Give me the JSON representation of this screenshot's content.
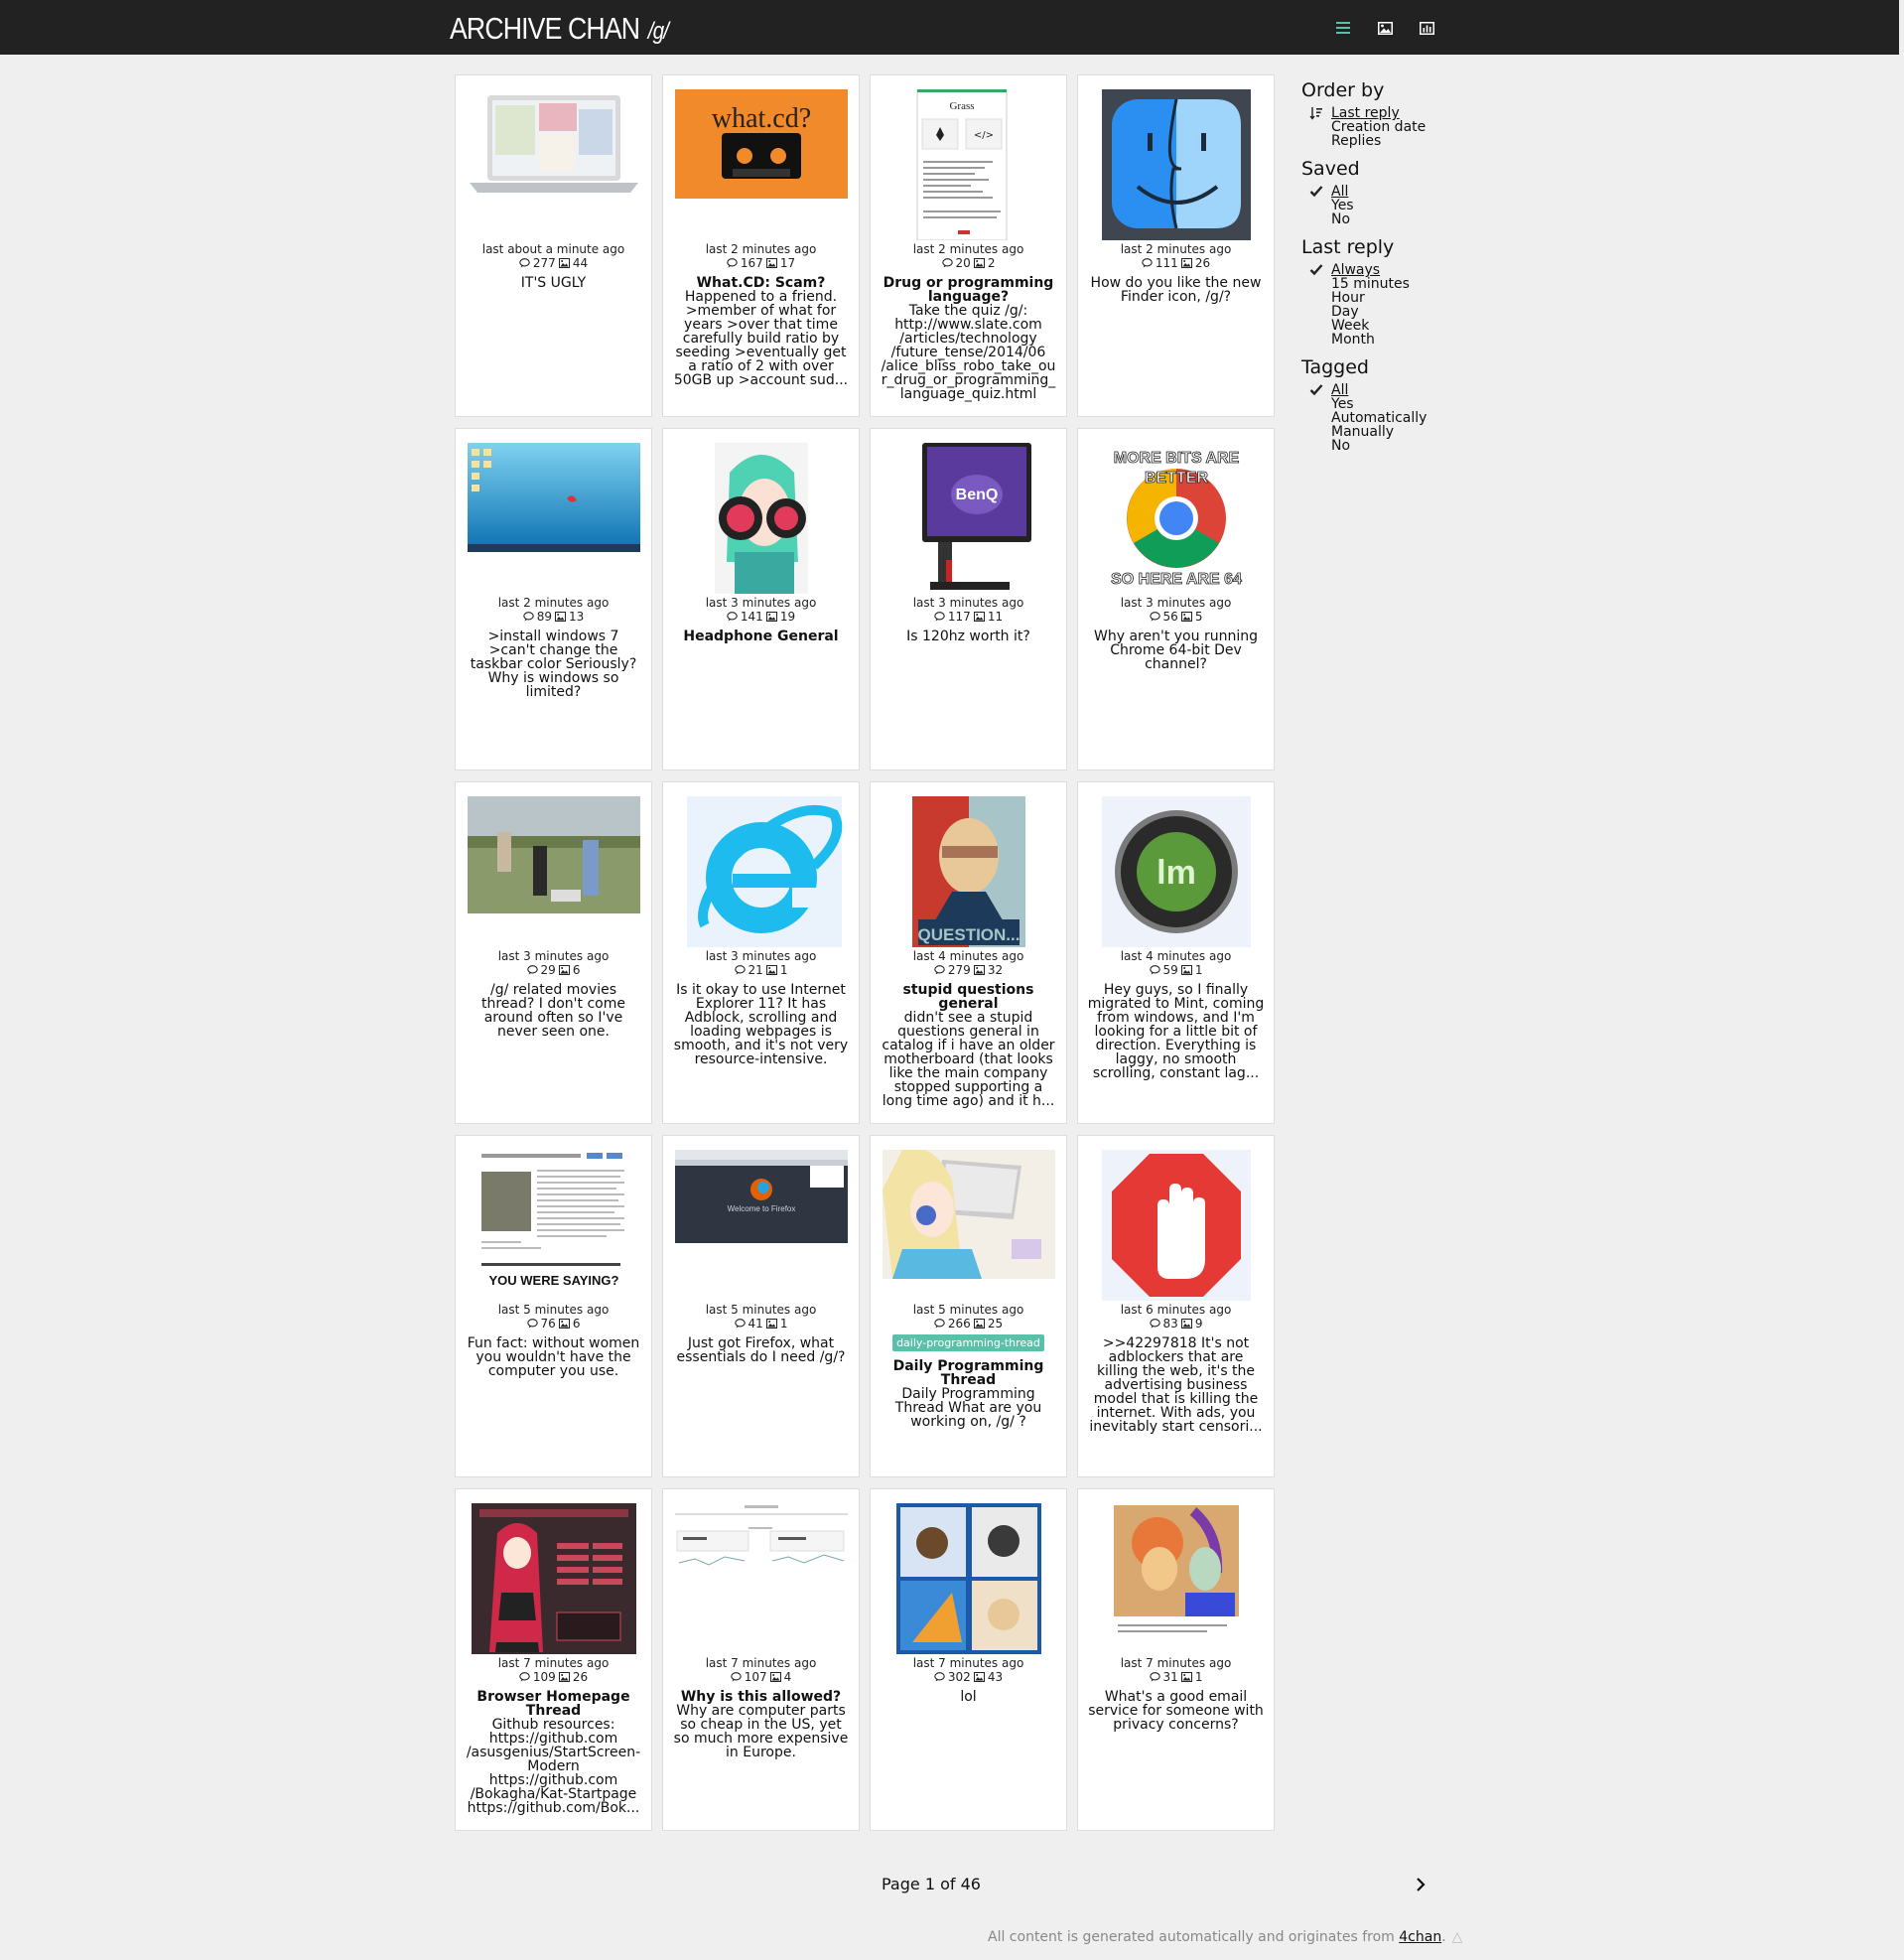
{
  "header": {
    "brand": "ARCHIVE CHAN",
    "board": "/g/",
    "icons": [
      "list-view-icon",
      "image-view-icon",
      "stats-icon"
    ]
  },
  "colors": {
    "topbar": "#222222",
    "accent": "#5bc0a8",
    "page_bg": "#efefef"
  },
  "threads": [
    {
      "last": "last about a minute ago",
      "replies": "277",
      "images": "44",
      "subject": "",
      "text": "IT'S UGLY",
      "thumb": "laptop"
    },
    {
      "last": "last 2 minutes ago",
      "replies": "167",
      "images": "17",
      "subject": "What.CD: Scam?",
      "text": "Happened to a friend. >member of what for years >over that time carefully build ratio by seeding >eventually get a ratio of 2 with over 50GB up >account sud...",
      "thumb": "whatcd"
    },
    {
      "last": "last 2 minutes ago",
      "replies": "20",
      "images": "2",
      "subject": "Drug or programming language?",
      "text": "Take the quiz /g/: http://www.slate.com /articles/technology /future_tense/2014/06 /alice_bliss_robo_take_ou r_drug_or_programming_ language_quiz.html",
      "thumb": "quiz"
    },
    {
      "last": "last 2 minutes ago",
      "replies": "111",
      "images": "26",
      "subject": "",
      "text": "How do you like the new Finder icon, /g/?",
      "thumb": "finder"
    },
    {
      "last": "last 2 minutes ago",
      "replies": "89",
      "images": "13",
      "subject": "",
      "text": ">install windows 7 >can't change the taskbar color Seriously? Why is windows so limited?",
      "thumb": "win7"
    },
    {
      "last": "last 3 minutes ago",
      "replies": "141",
      "images": "19",
      "subject": "Headphone General",
      "text": "",
      "thumb": "anime-headphones"
    },
    {
      "last": "last 3 minutes ago",
      "replies": "117",
      "images": "11",
      "subject": "",
      "text": "Is 120hz worth it?",
      "thumb": "benq"
    },
    {
      "last": "last 3 minutes ago",
      "replies": "56",
      "images": "5",
      "subject": "",
      "text": "Why aren't you running Chrome 64-bit Dev channel?",
      "thumb": "chrome",
      "meme_top": "MORE BITS ARE BETTER",
      "meme_bottom": "SO HERE ARE 64"
    },
    {
      "last": "last 3 minutes ago",
      "replies": "29",
      "images": "6",
      "subject": "",
      "text": "/g/ related movies thread? I don't come around often so I've never seen one.",
      "thumb": "officespace"
    },
    {
      "last": "last 3 minutes ago",
      "replies": "21",
      "images": "1",
      "subject": "",
      "text": "Is it okay to use Internet Explorer 11? It has Adblock, scrolling and loading webpages is smooth, and it's not very resource-intensive.",
      "thumb": "ie"
    },
    {
      "last": "last 4 minutes ago",
      "replies": "279",
      "images": "32",
      "subject": "stupid questions general",
      "text": "didn't see a stupid questions general in catalog if i have an older motherboard (that looks like the main company stopped supporting a long time ago) and it h...",
      "thumb": "question",
      "poster_text": "QUESTION..."
    },
    {
      "last": "last 4 minutes ago",
      "replies": "59",
      "images": "1",
      "subject": "",
      "text": "Hey guys, so I finally migrated to Mint, coming from windows, and I'm looking for a little bit of direction. Everything is laggy, no smooth scrolling, constant lag...",
      "thumb": "mint"
    },
    {
      "last": "last 5 minutes ago",
      "replies": "76",
      "images": "6",
      "subject": "",
      "text": "Fun fact: without women you wouldn't have the computer you use.",
      "thumb": "article",
      "caption": "YOU WERE SAYING?"
    },
    {
      "last": "last 5 minutes ago",
      "replies": "41",
      "images": "1",
      "subject": "",
      "text": "Just got Firefox, what essentials do I need /g/?",
      "thumb": "firefox",
      "screen_text": "Welcome to Firefox"
    },
    {
      "last": "last 5 minutes ago",
      "replies": "266",
      "images": "25",
      "tag": "daily-programming-thread",
      "subject": "Daily Programming Thread",
      "text": "Daily Programming Thread What are you working on, /g/ ?",
      "thumb": "anime-laptop"
    },
    {
      "last": "last 6 minutes ago",
      "replies": "83",
      "images": "9",
      "subject": "",
      "text": ">>42297818 It's not adblockers that are killing the web, it's the advertising business model that is killing the internet. With ads, you inevitably start censori...",
      "thumb": "adblock"
    },
    {
      "last": "last 7 minutes ago",
      "replies": "109",
      "images": "26",
      "subject": "Browser Homepage Thread",
      "text": "Github resources: https://github.com /asusgenius/StartScreen-Modern https://github.com /Bokagha/Kat-Startpage https://github.com/Bok...",
      "thumb": "startpage"
    },
    {
      "last": "last 7 minutes ago",
      "replies": "107",
      "images": "4",
      "subject": "Why is this allowed?",
      "text": "Why are computer parts so cheap in the US, yet so much more expensive in Europe.",
      "thumb": "prices"
    },
    {
      "last": "last 7 minutes ago",
      "replies": "302",
      "images": "43",
      "subject": "",
      "text": "lol",
      "thumb": "comic"
    },
    {
      "last": "last 7 minutes ago",
      "replies": "31",
      "images": "1",
      "subject": "",
      "text": "What's a good email service for someone with privacy concerns?",
      "thumb": "cartoon"
    }
  ],
  "sidebar": {
    "order_by": {
      "title": "Order by",
      "items": [
        "Last reply",
        "Creation date",
        "Replies"
      ],
      "active": "Last reply"
    },
    "saved": {
      "title": "Saved",
      "items": [
        "All",
        "Yes",
        "No"
      ],
      "active": "All"
    },
    "last_reply": {
      "title": "Last reply",
      "items": [
        "Always",
        "15 minutes",
        "Hour",
        "Day",
        "Week",
        "Month"
      ],
      "active": "Always"
    },
    "tagged": {
      "title": "Tagged",
      "items": [
        "All",
        "Yes",
        "Automatically",
        "Manually",
        "No"
      ],
      "active": "All"
    }
  },
  "pager": {
    "label": "Page 1 of 46"
  },
  "footer": {
    "text": "All content is generated automatically and originates from ",
    "link": "4chan",
    "suffix": "."
  }
}
